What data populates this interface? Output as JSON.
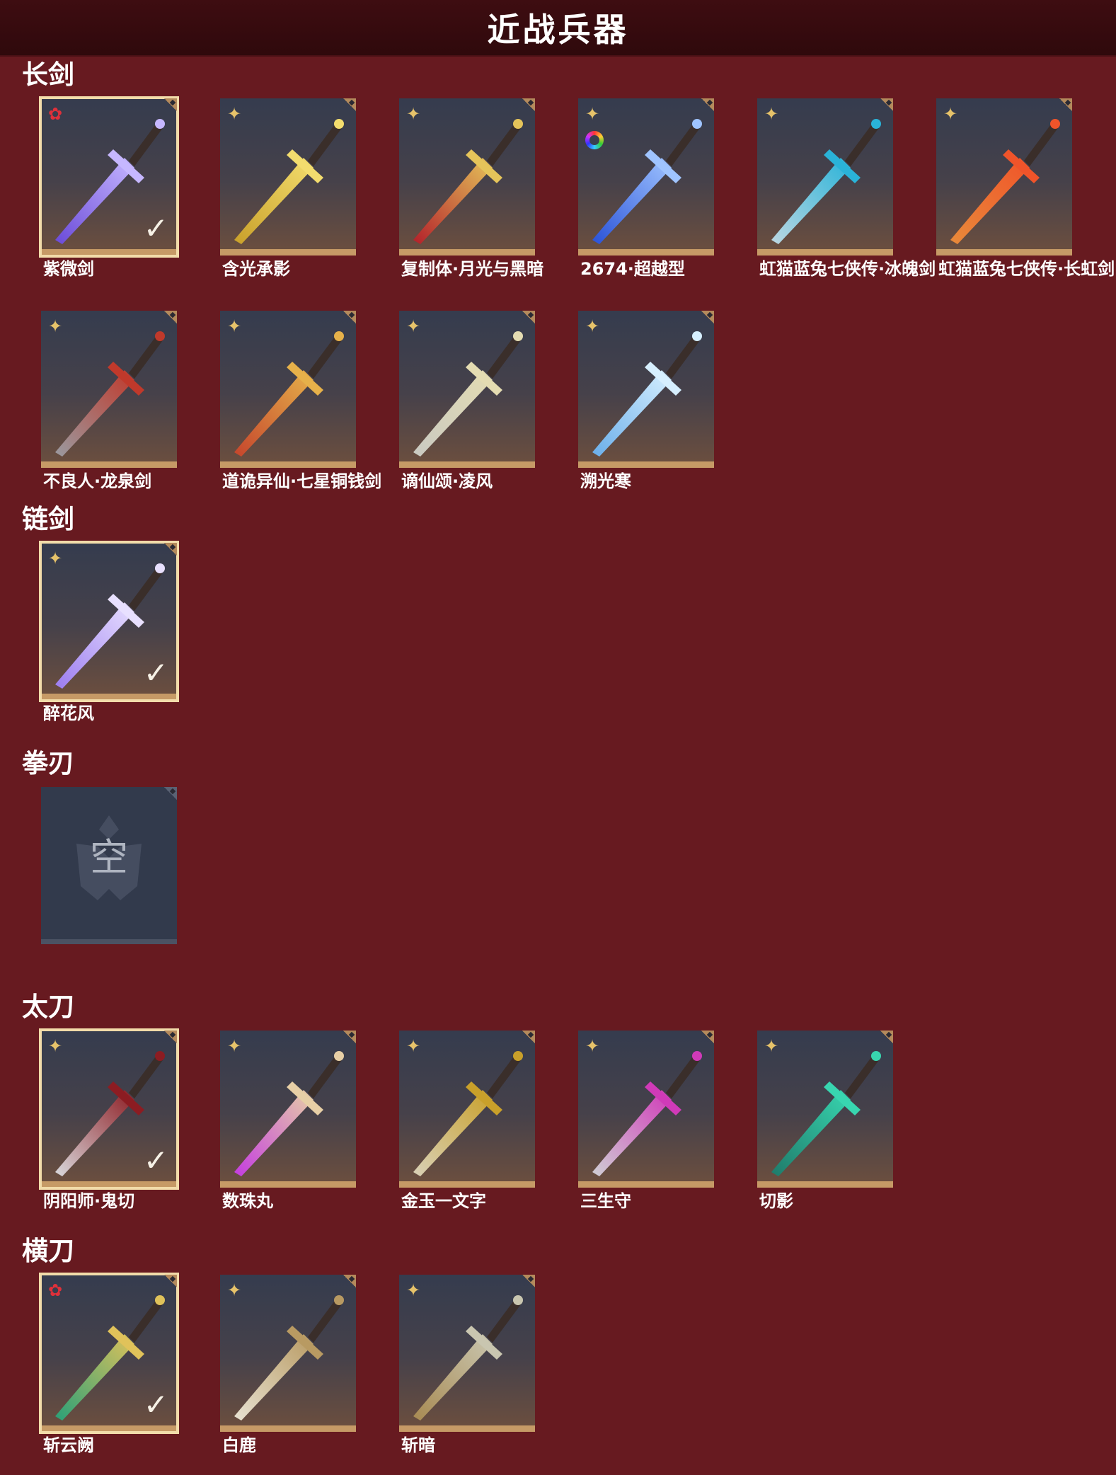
{
  "header": {
    "title": "近战兵器"
  },
  "categories": [
    {
      "title": "长剑",
      "items": [
        {
          "name": "紫微剑",
          "badge": "red",
          "selected": true,
          "rainbow": false,
          "colors": [
            "#6a4ad8",
            "#c6b7ff"
          ]
        },
        {
          "name": "含光承影",
          "badge": "gold",
          "selected": false,
          "rainbow": false,
          "colors": [
            "#c9a02a",
            "#f3dd6e"
          ]
        },
        {
          "name": "复制体·月光与黑暗",
          "badge": "gold",
          "selected": false,
          "rainbow": false,
          "colors": [
            "#b3202a",
            "#e5c45a"
          ]
        },
        {
          "name": "2674·超越型",
          "badge": "gold",
          "selected": false,
          "rainbow": true,
          "colors": [
            "#2a52d8",
            "#9fc4ff"
          ]
        },
        {
          "name": "虹猫蓝兔七侠传·冰魄剑",
          "badge": "gold",
          "selected": false,
          "rainbow": false,
          "colors": [
            "#bcd7e2",
            "#2ab3d8"
          ]
        },
        {
          "name": "虹猫蓝兔七侠传·长虹剑",
          "badge": "gold",
          "selected": false,
          "rainbow": false,
          "colors": [
            "#e88a3a",
            "#f0542a"
          ]
        },
        {
          "name": "不良人·龙泉剑",
          "badge": "gold",
          "selected": false,
          "rainbow": false,
          "colors": [
            "#9a9aa0",
            "#c0392b"
          ]
        },
        {
          "name": "道诡异仙·七星铜钱剑",
          "badge": "gold",
          "selected": false,
          "rainbow": false,
          "colors": [
            "#c5452c",
            "#e6b14a"
          ]
        },
        {
          "name": "谪仙颂·凌风",
          "badge": "gold",
          "selected": false,
          "rainbow": false,
          "colors": [
            "#c9c9c2",
            "#e4dcb2"
          ]
        },
        {
          "name": "溯光寒",
          "badge": "gold",
          "selected": false,
          "rainbow": false,
          "colors": [
            "#6aaeea",
            "#d6efff"
          ]
        }
      ]
    },
    {
      "title": "链剑",
      "items": [
        {
          "name": "醉花风",
          "badge": "gold",
          "selected": true,
          "rainbow": false,
          "colors": [
            "#9b7cf0",
            "#e8e0ff"
          ]
        }
      ]
    },
    {
      "title": "拳刃",
      "empty_text": "空",
      "items": []
    },
    {
      "title": "太刀",
      "items": [
        {
          "name": "阴阳师·鬼切",
          "badge": "gold",
          "selected": true,
          "rainbow": false,
          "colors": [
            "#d9d9dd",
            "#8c1c22"
          ]
        },
        {
          "name": "数珠丸",
          "badge": "gold",
          "selected": false,
          "rainbow": false,
          "colors": [
            "#c43ce0",
            "#e7cfa6"
          ]
        },
        {
          "name": "金玉一文字",
          "badge": "gold",
          "selected": false,
          "rainbow": false,
          "colors": [
            "#d9d1b8",
            "#c9a02a"
          ]
        },
        {
          "name": "三生守",
          "badge": "gold",
          "selected": false,
          "rainbow": false,
          "colors": [
            "#cfcfd4",
            "#d03ab8"
          ]
        },
        {
          "name": "切影",
          "badge": "gold",
          "selected": false,
          "rainbow": false,
          "colors": [
            "#1f7a6a",
            "#38d6b0"
          ]
        }
      ]
    },
    {
      "title": "横刀",
      "items": [
        {
          "name": "斩云阙",
          "badge": "red",
          "selected": true,
          "rainbow": false,
          "colors": [
            "#2aa078",
            "#e0c25a"
          ]
        },
        {
          "name": "白鹿",
          "badge": "gold",
          "selected": false,
          "rainbow": false,
          "colors": [
            "#e8e2d2",
            "#b89a62"
          ]
        },
        {
          "name": "斩暗",
          "badge": "gold",
          "selected": false,
          "rainbow": false,
          "colors": [
            "#a88a52",
            "#c9c6b0"
          ]
        }
      ]
    }
  ]
}
